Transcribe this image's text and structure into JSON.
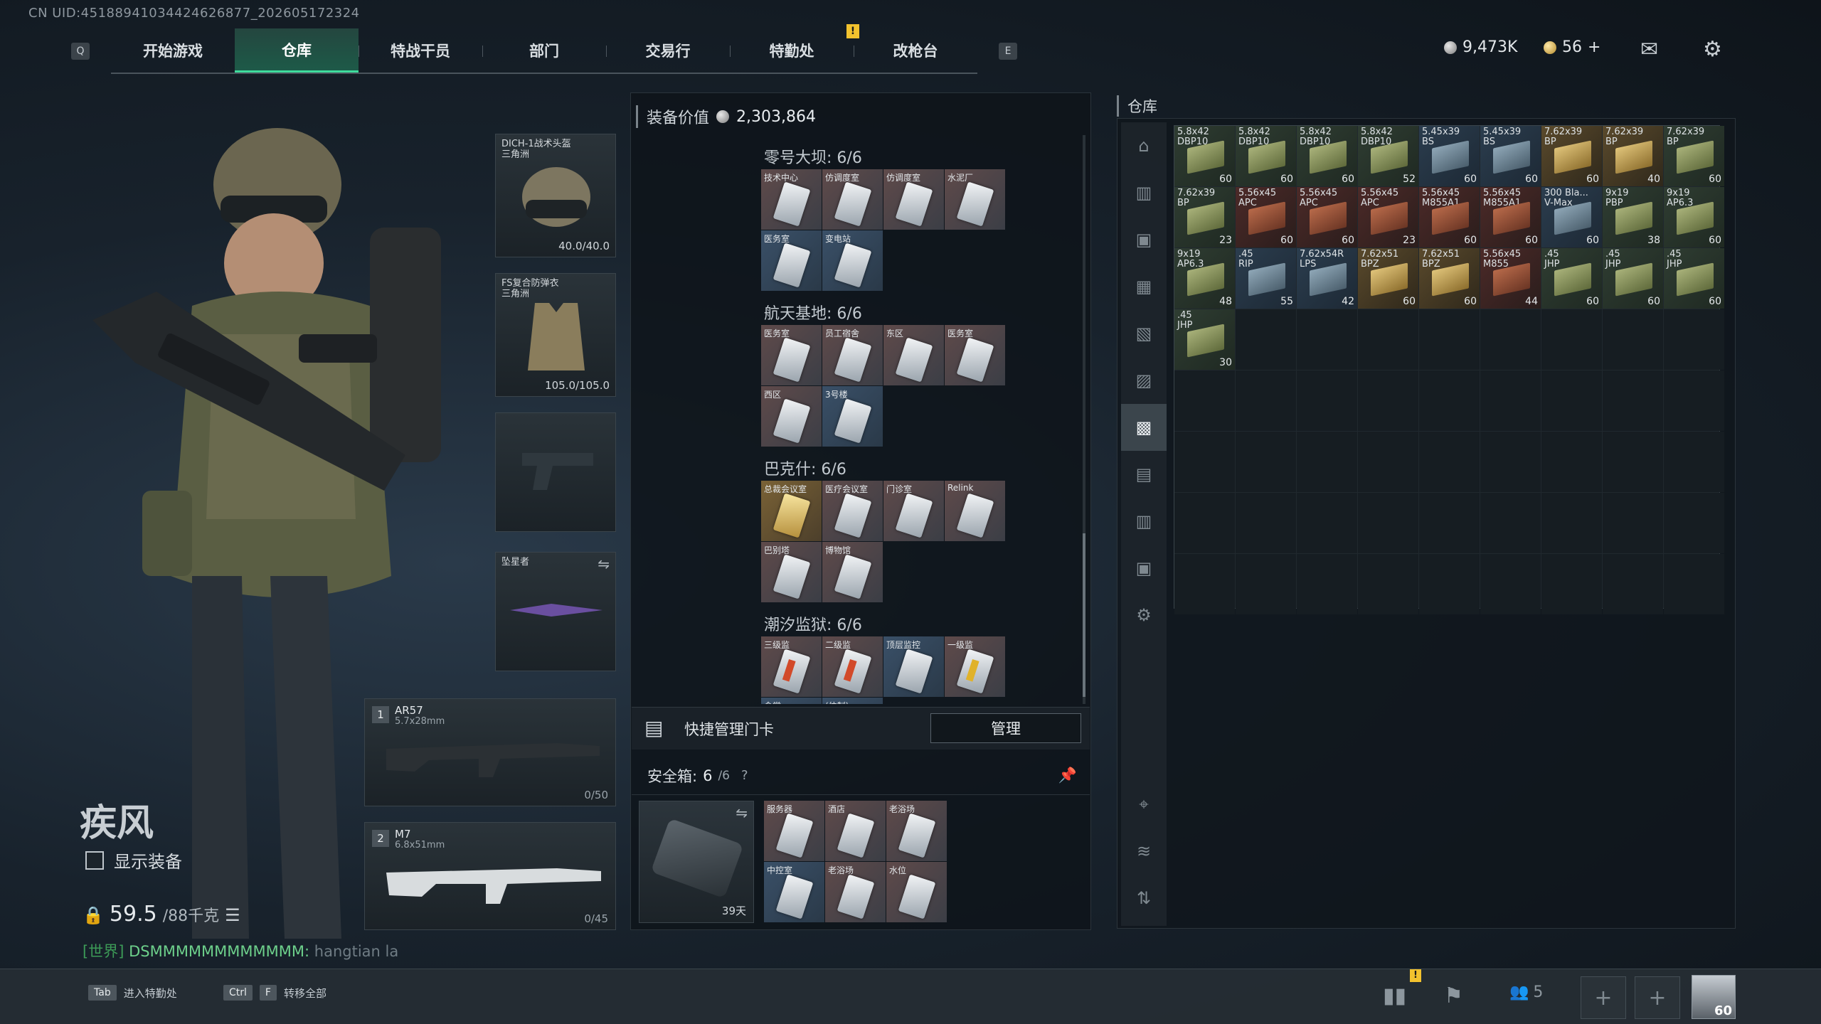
{
  "uid": "CN UID:4518894103442462687​7_202605172324",
  "nav": {
    "left_key": "Q",
    "right_key": "E",
    "alert": "!",
    "tabs": [
      "开始游戏",
      "仓库",
      "特战干员",
      "部门",
      "交易行",
      "特勤处",
      "改枪台"
    ],
    "active_tab": "仓库"
  },
  "currency": {
    "silver": "9,473K",
    "gold": "56",
    "gold_add": "+"
  },
  "operator": {
    "name": "疾风",
    "show_equipment_label": "显示装备",
    "weight": "59.5",
    "weight_max": "/88千克"
  },
  "chat": {
    "channel": "[世界]",
    "sender": "DSMMMMMMMMMMMM:",
    "message": "hangtian la"
  },
  "equipment": {
    "helmet": {
      "name": "DICH-1战术头盔",
      "sub": "三角洲",
      "durability": "40.0/40.0"
    },
    "armor": {
      "name": "FS复合防弹衣",
      "sub": "三角洲",
      "durability": "105.0/105.0"
    },
    "melee": {
      "name": "坠星者"
    },
    "primary": {
      "slot": "1",
      "name": "AR57",
      "caliber": "5.7x28mm",
      "ammo": "0/50"
    },
    "secondary": {
      "slot": "2",
      "name": "M7",
      "caliber": "6.8x51mm",
      "ammo": "0/45"
    }
  },
  "equipment_value": {
    "label": "装备价值",
    "value": "2,303,864"
  },
  "keycard_sections": [
    {
      "title": "零号大坝: 6/6",
      "cards": [
        {
          "name": "技术中心",
          "style": "red"
        },
        {
          "name": "仿调度室",
          "style": "red"
        },
        {
          "name": "仿调度室",
          "style": "red"
        },
        {
          "name": "水泥厂",
          "style": "red"
        },
        {
          "name": "医务室",
          "style": "blue"
        },
        {
          "name": "变电站",
          "style": "blue"
        }
      ]
    },
    {
      "title": "航天基地: 6/6",
      "cards": [
        {
          "name": "医务室",
          "style": "red"
        },
        {
          "name": "员工宿舍",
          "style": "red"
        },
        {
          "name": "东区",
          "style": "red"
        },
        {
          "name": "医务室",
          "style": "red"
        },
        {
          "name": "西区",
          "style": "red"
        },
        {
          "name": "3号楼",
          "style": "blue"
        }
      ]
    },
    {
      "title": "巴克什: 6/6",
      "cards": [
        {
          "name": "总裁会议室",
          "style": "gold"
        },
        {
          "name": "医疗会议室",
          "style": "red"
        },
        {
          "name": "门诊室",
          "style": "red"
        },
        {
          "name": "Relink",
          "style": "red"
        },
        {
          "name": "巴别塔",
          "style": "red"
        },
        {
          "name": "博物馆",
          "style": "red"
        }
      ]
    },
    {
      "title": "潮汐监狱: 6/6",
      "cards": [
        {
          "name": "三级监",
          "style": "red",
          "stripe": "red"
        },
        {
          "name": "二级监",
          "style": "red",
          "stripe": "red"
        },
        {
          "name": "顶层监控",
          "style": "blue"
        },
        {
          "name": "一级监",
          "style": "red",
          "stripe": "yel"
        },
        {
          "name": "食堂",
          "style": "blue"
        },
        {
          "name": "(仿制)",
          "style": "blue"
        }
      ]
    }
  ],
  "quick_card": {
    "label": "快捷管理门卡",
    "button": "管理"
  },
  "safe_box": {
    "label": "安全箱:",
    "count": "6",
    "capacity": "/6",
    "help": "?",
    "days": "39天",
    "cards": [
      {
        "name": "服务器",
        "style": "red"
      },
      {
        "name": "酒店",
        "style": "red"
      },
      {
        "name": "老浴场",
        "style": "red"
      },
      {
        "name": "中控室",
        "style": "blue"
      },
      {
        "name": "老浴场",
        "style": "red"
      },
      {
        "name": "水位",
        "style": "red"
      }
    ]
  },
  "warehouse": {
    "title": "仓库",
    "items": [
      {
        "name": "5.8x42",
        "sub": "DBP10",
        "count": "60",
        "style": "filled"
      },
      {
        "name": "5.8x42",
        "sub": "DBP10",
        "count": "60",
        "style": "filled"
      },
      {
        "name": "5.8x42",
        "sub": "DBP10",
        "count": "60",
        "style": "filled"
      },
      {
        "name": "5.8x42",
        "sub": "DBP10",
        "count": "52",
        "style": "filled"
      },
      {
        "name": "5.45x39",
        "sub": "BS",
        "count": "60",
        "style": "blue"
      },
      {
        "name": "5.45x39",
        "sub": "BS",
        "count": "60",
        "style": "blue"
      },
      {
        "name": "7.62x39",
        "sub": "BP",
        "count": "60",
        "style": "gold"
      },
      {
        "name": "7.62x39",
        "sub": "BP",
        "count": "40",
        "style": "gold"
      },
      {
        "name": "7.62x39",
        "sub": "BP",
        "count": "60",
        "style": "filled"
      },
      {
        "name": "7.62x39",
        "sub": "BP",
        "count": "23",
        "style": "filled"
      },
      {
        "name": "5.56x45",
        "sub": "APC",
        "count": "60",
        "style": "red"
      },
      {
        "name": "5.56x45",
        "sub": "APC",
        "count": "60",
        "style": "red"
      },
      {
        "name": "5.56x45",
        "sub": "APC",
        "count": "23",
        "style": "red"
      },
      {
        "name": "5.56x45",
        "sub": "M855A1",
        "count": "60",
        "style": "red"
      },
      {
        "name": "5.56x45",
        "sub": "M855A1",
        "count": "60",
        "style": "red"
      },
      {
        "name": "300 Bla...",
        "sub": "V-Max",
        "count": "60",
        "style": "blue"
      },
      {
        "name": "9x19",
        "sub": "PBP",
        "count": "38",
        "style": "filled"
      },
      {
        "name": "9x19",
        "sub": "AP6.3",
        "count": "60",
        "style": "filled"
      },
      {
        "name": "9x19",
        "sub": "AP6.3",
        "count": "48",
        "style": "filled"
      },
      {
        "name": ".45",
        "sub": "RIP",
        "count": "55",
        "style": "blue"
      },
      {
        "name": "7.62x54R",
        "sub": "LPS",
        "count": "42",
        "style": "blue"
      },
      {
        "name": "7.62x51",
        "sub": "BPZ",
        "count": "60",
        "style": "gold"
      },
      {
        "name": "7.62x51",
        "sub": "BPZ",
        "count": "60",
        "style": "gold"
      },
      {
        "name": "5.56x45",
        "sub": "M855",
        "count": "44",
        "style": "red"
      },
      {
        "name": ".45",
        "sub": "JHP",
        "count": "60",
        "style": "filled"
      },
      {
        "name": ".45",
        "sub": "JHP",
        "count": "60",
        "style": "filled"
      },
      {
        "name": ".45",
        "sub": "JHP",
        "count": "60",
        "style": "filled"
      },
      {
        "name": ".45",
        "sub": "JHP",
        "count": "30",
        "style": "filled"
      }
    ]
  },
  "bottom": {
    "hint1_key": "Tab",
    "hint1_label": "进入特勤处",
    "hint2_key1": "Ctrl",
    "hint2_key2": "F",
    "hint2_label": "转移全部",
    "friends": "5",
    "level": "60",
    "alert": "!"
  }
}
